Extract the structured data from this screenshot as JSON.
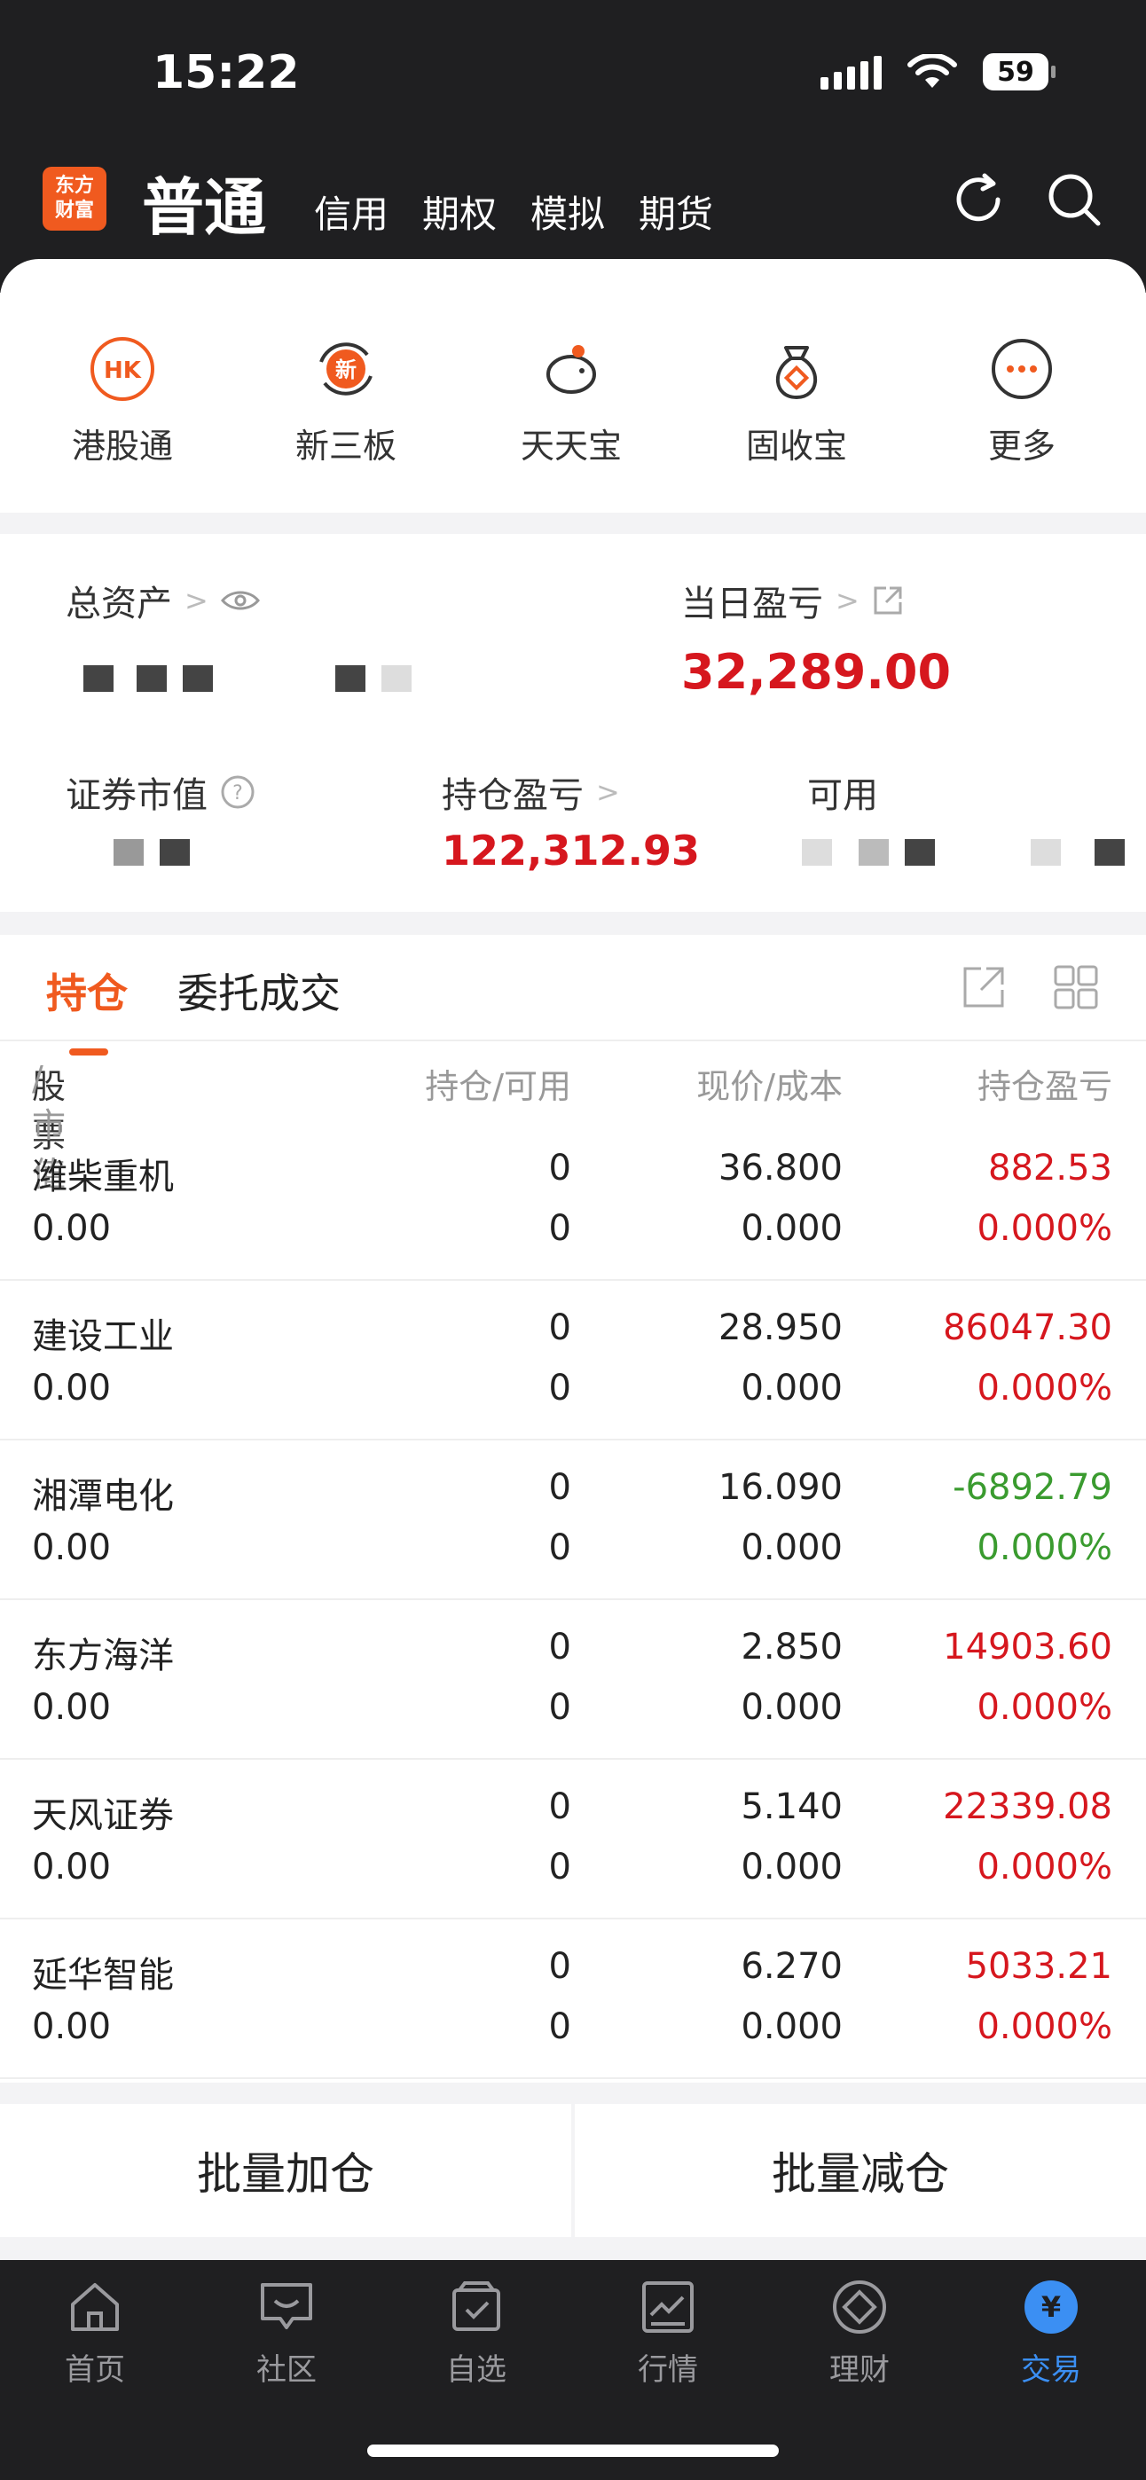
{
  "status": {
    "time": "15:22",
    "battery": "59"
  },
  "header": {
    "logo": "东方\n财富",
    "active_tab": "普通",
    "tabs": [
      "信用",
      "期权",
      "模拟",
      "期货"
    ]
  },
  "quick": [
    {
      "label": "港股通",
      "icon": "hk-icon"
    },
    {
      "label": "新三板",
      "icon": "new-board-icon"
    },
    {
      "label": "天天宝",
      "icon": "piggy-bank-icon"
    },
    {
      "label": "固收宝",
      "icon": "money-bag-icon"
    },
    {
      "label": "更多",
      "icon": "more-icon"
    }
  ],
  "assets": {
    "total_label": "总资产",
    "daily_label": "当日盈亏",
    "daily_value": "32,289.00",
    "market_label": "证券市值",
    "holding_pl_label": "持仓盈亏",
    "holding_pl_value": "122,312.93",
    "available_label": "可用"
  },
  "positions": {
    "tabs": [
      "持仓",
      "委托成交"
    ],
    "headers": {
      "name": "股票",
      "name2": "/市值",
      "hold": "持仓/可用",
      "price": "现价/成本",
      "pl": "持仓盈亏"
    },
    "rows": [
      {
        "name": "潍柴重机",
        "mv": "0.00",
        "hold": "0",
        "avail": "0",
        "price": "36.800",
        "cost": "0.000",
        "pl": "882.53",
        "pct": "0.000%",
        "tone": "red"
      },
      {
        "name": "建设工业",
        "mv": "0.00",
        "hold": "0",
        "avail": "0",
        "price": "28.950",
        "cost": "0.000",
        "pl": "86047.30",
        "pct": "0.000%",
        "tone": "red"
      },
      {
        "name": "湘潭电化",
        "mv": "0.00",
        "hold": "0",
        "avail": "0",
        "price": "16.090",
        "cost": "0.000",
        "pl": "-6892.79",
        "pct": "0.000%",
        "tone": "green"
      },
      {
        "name": "东方海洋",
        "mv": "0.00",
        "hold": "0",
        "avail": "0",
        "price": "2.850",
        "cost": "0.000",
        "pl": "14903.60",
        "pct": "0.000%",
        "tone": "red"
      },
      {
        "name": "天风证券",
        "mv": "0.00",
        "hold": "0",
        "avail": "0",
        "price": "5.140",
        "cost": "0.000",
        "pl": "22339.08",
        "pct": "0.000%",
        "tone": "red"
      },
      {
        "name": "延华智能",
        "mv": "0.00",
        "hold": "0",
        "avail": "0",
        "price": "6.270",
        "cost": "0.000",
        "pl": "5033.21",
        "pct": "0.000%",
        "tone": "red"
      }
    ]
  },
  "batch": {
    "add": "批量加仓",
    "reduce": "批量减仓"
  },
  "tabbar": [
    {
      "label": "首页",
      "icon": "home-icon"
    },
    {
      "label": "社区",
      "icon": "community-icon"
    },
    {
      "label": "自选",
      "icon": "watchlist-icon"
    },
    {
      "label": "行情",
      "icon": "market-icon"
    },
    {
      "label": "理财",
      "icon": "wealth-icon"
    },
    {
      "label": "交易",
      "icon": "trade-icon"
    }
  ],
  "colors": {
    "accent": "#f05a1f",
    "up": "#d6171e",
    "down": "#3a9b2f",
    "tab_active": "#3b8ff3"
  }
}
